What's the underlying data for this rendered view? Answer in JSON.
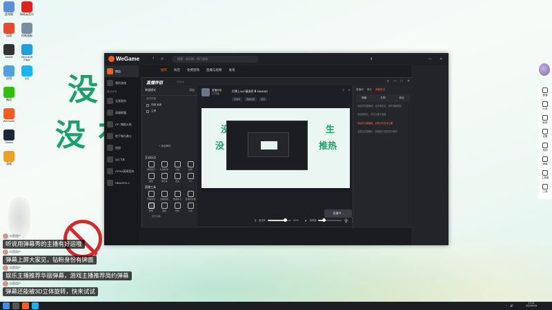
{
  "wallpaper": {
    "line1": "没有……生",
    "line2": "没有……推热"
  },
  "desktop_icons": [
    {
      "label": "此电脑",
      "icon": "computer-icon",
      "color": "#5b8fd9"
    },
    {
      "label": "网易云音乐",
      "icon": "netease-music-icon",
      "color": "#e2231a"
    },
    {
      "label": "迅游",
      "icon": "xunyou-icon",
      "color": "#e84a2e"
    },
    {
      "label": "控制面板",
      "icon": "control-panel-icon",
      "color": "#7a8ca6"
    },
    {
      "label": "Adobe",
      "icon": "adobe-icon",
      "color": "#333333"
    },
    {
      "label": "Microsoft Edge",
      "icon": "edge-icon",
      "color": "#1ba1e2"
    },
    {
      "label": "应用",
      "icon": "app-icon",
      "color": "#4aa3df"
    },
    {
      "label": "QQ",
      "icon": "qq-icon",
      "color": "#12b7f5"
    },
    {
      "label": "微信",
      "icon": "wechat-icon",
      "color": "#2dc100"
    },
    {
      "label": "WeGame",
      "icon": "wegame-icon",
      "color": "#ff5a1f"
    },
    {
      "label": "Steam",
      "icon": "steam-icon",
      "color": "#1b2838"
    },
    {
      "label": "游戏",
      "icon": "game-icon",
      "color": "#f0a020"
    }
  ],
  "wegame": {
    "logo": "WeGame",
    "search_placeholder": "搜索：求大神、热门游戏",
    "tabs": [
      "推荐",
      "商店",
      "免费游戏",
      "直播与视频",
      "发现"
    ],
    "active_tab": 0,
    "sidebar": [
      {
        "label": "商店",
        "icon": "store-icon"
      },
      {
        "label": "我的游戏",
        "icon": "library-icon"
      }
    ],
    "section_label": "最近游戏",
    "games": [
      {
        "label": "无畏契约",
        "icon": "valorant-icon"
      },
      {
        "label": "英雄联盟",
        "icon": "lol-icon"
      },
      {
        "label": "CF: 穿越火线",
        "icon": "cf-icon"
      },
      {
        "label": "地下城与勇士",
        "icon": "dnf-icon"
      },
      {
        "label": "逆战",
        "icon": "nz-icon"
      },
      {
        "label": "QQ飞车",
        "icon": "qqspeed-icon"
      },
      {
        "label": "CFHD高清竞技",
        "icon": "cfhd-icon"
      },
      {
        "label": "NBA2KOL2",
        "icon": "nba-icon"
      }
    ]
  },
  "zhibo": {
    "title": "直播伴侣",
    "version": "V2.5.4",
    "scene_label": "常规模式",
    "scene_add": "添加",
    "source_section": "我的场景",
    "sources": [
      "场景 画面",
      "主屏"
    ],
    "add_source": "+ 添加素材",
    "interact_title": "互动玩法",
    "interact_tools": [
      "弹幕助手",
      "礼物特效",
      "点歌",
      "投票",
      "抽奖",
      "排行榜",
      "连麦",
      "PK"
    ],
    "tools_title": "直播工具",
    "live_tools": [
      "开播设置",
      "直播回放",
      "数据中心",
      "直播间管理",
      "弹幕",
      "美颜",
      "特效",
      "分享"
    ],
    "more_label": "更多功能",
    "user_name": "直播伴侣",
    "user_sub": "已开播",
    "room_title": "灯牌上3x3 精选秀 Ⅲ 5564682",
    "stats": [
      "0",
      "5"
    ],
    "badges": [
      "正播中",
      "直播设置",
      "互动"
    ],
    "mic_label": "麦克风",
    "mic_value": "100%",
    "speaker_label": "扬声器",
    "speaker_value": "24%",
    "mic_level": 0.75,
    "speaker_level": 0.24,
    "bottom_icons": [
      "主题",
      "设置"
    ],
    "go_live": "直播中...",
    "right_tabs": [
      "直播间",
      "观众",
      "弹幕助手"
    ],
    "right_active": 2,
    "right_subtabs": [
      "弹幕",
      "礼物",
      "粉丝"
    ],
    "messages": [
      {
        "text": "欢迎来到直播间，请文明发言，遵守直播规范",
        "highlight": false
      },
      {
        "text": "欢迎新朋友，关注主播不迷路",
        "highlight": false
      },
      {
        "text": "欢迎关注直播间，点赞分享支持主播",
        "highlight": true
      },
      {
        "text": "主播正在直播中，感谢观众的支持与陪伴",
        "highlight": false
      }
    ]
  },
  "float_bar": [
    {
      "label": "直播",
      "icon": "live-icon"
    },
    {
      "label": "分享",
      "icon": "share-icon"
    },
    {
      "label": "刷新",
      "icon": "refresh-icon"
    },
    {
      "label": "设置",
      "icon": "settings-icon"
    },
    {
      "label": "录制",
      "icon": "record-icon"
    },
    {
      "label": "弹幕",
      "icon": "danmu-icon"
    },
    {
      "label": "工具箱",
      "icon": "toolbox-icon"
    },
    {
      "label": "工具",
      "icon": "tool-icon"
    }
  ],
  "danmu": [
    {
      "user": "抖音用户",
      "text": "听说用弹幕秀的主播有好运哦"
    },
    {
      "user": "抖音用户",
      "text": "弹幕上屏大家见，钻粉身份有牌面"
    },
    {
      "user": "抖音用户",
      "text": "娱乐主播推荐华丽弹幕，游戏主播推荐简约弹幕"
    },
    {
      "user": "抖音用户",
      "text": "弹幕还能被3D立体旋转，快来试试"
    }
  ],
  "taskbar": {
    "time": "17:02",
    "date": "2023/5/19"
  }
}
